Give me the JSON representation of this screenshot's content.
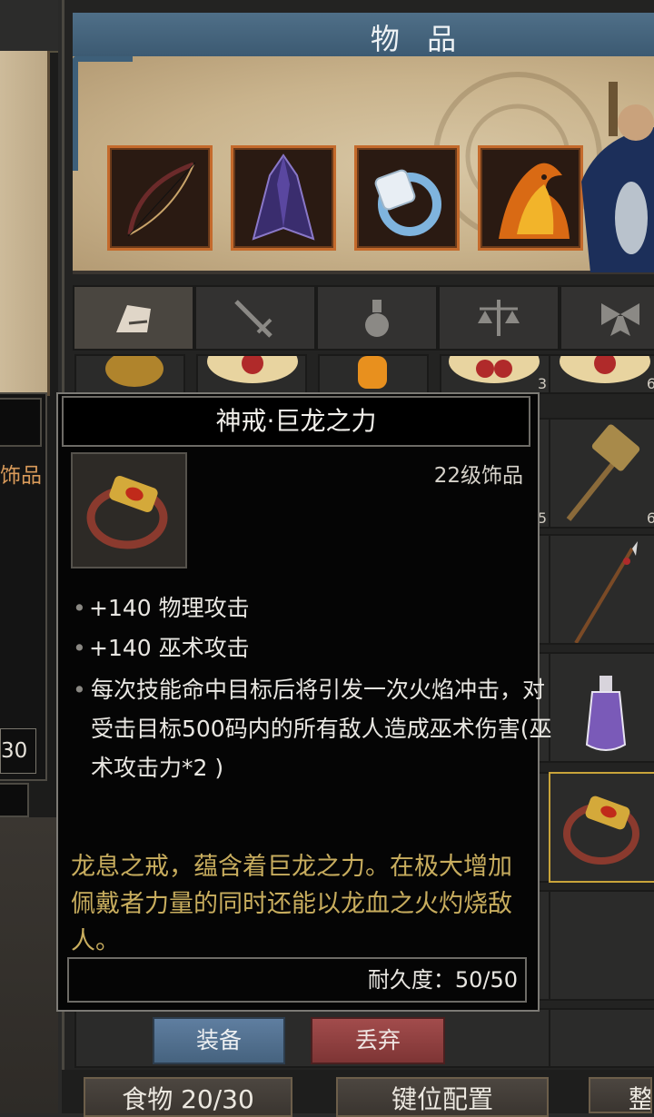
{
  "window": {
    "title": "物 品"
  },
  "left_panel": {
    "category_partial": "饰品",
    "count_partial": "30"
  },
  "grid_counts": [
    "3",
    "6",
    "5",
    "6"
  ],
  "tooltip": {
    "item_name": "神戒·巨龙之力",
    "level_type": "22级饰品",
    "stats": [
      "+140 物理攻击",
      "+140 巫术攻击"
    ],
    "effect": "每次技能命中目标后将引发一次火焰冲击，对受击目标500码内的所有敌人造成巫术伤害(巫术攻击力*2 )",
    "description": "龙息之戒，蕴含着巨龙之力。在极大增加佩戴者力量的同时还能以龙血之火灼烧敌人。",
    "durability_label": "耐久度：50/50"
  },
  "actions": {
    "equip": "装备",
    "discard": "丢弃"
  },
  "bottom_bar": {
    "food": "食物 20/30",
    "keymap": "键位配置",
    "sort_partial": "整"
  },
  "colors": {
    "title_bar": "#4f6f88",
    "slot_border": "#c46a2c",
    "desc_text": "#c8ad5e",
    "equip_button": "#5f7ea0",
    "discard_button": "#a24c4c"
  },
  "icons": {
    "equip_slots": [
      "bow-icon",
      "cloak-icon",
      "ring-icon",
      "phoenix-icon"
    ],
    "tabs": [
      "armor-icon",
      "sword-icon",
      "potion-icon",
      "scale-icon",
      "bow-ribbon-icon"
    ]
  }
}
